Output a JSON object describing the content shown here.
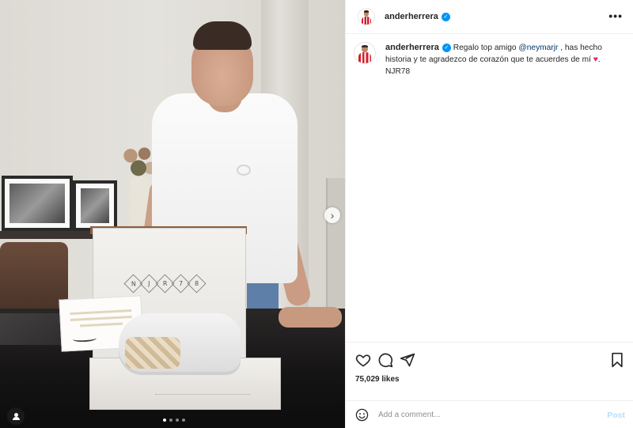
{
  "post": {
    "author": "anderherrera",
    "verified": true,
    "verified_icon": "verified-badge-icon",
    "more_label": "•••"
  },
  "caption": {
    "username": "anderherrera",
    "text_before": "Regalo top amigo ",
    "mention": "@neymarjr",
    "text_after": " , has hecho historia y te agradezco de corazón que te acuerdes de mí ",
    "emoji": "♥",
    "second_line": "NJR78"
  },
  "media": {
    "box_code": [
      "N",
      "J",
      "R",
      "7",
      "8"
    ],
    "next_icon": "chevron-right-icon",
    "tag_icon": "user-tag-icon",
    "carousel_count": 4,
    "carousel_active": 0
  },
  "actions": {
    "like_icon": "heart-icon",
    "comment_icon": "comment-icon",
    "share_icon": "send-icon",
    "save_icon": "bookmark-icon"
  },
  "likes": {
    "count_text": "75,029 likes"
  },
  "comment": {
    "placeholder": "Add a comment...",
    "post_label": "Post",
    "emoji_icon": "smiley-icon"
  },
  "colors": {
    "accent": "#0095f6",
    "post_disabled": "#b2dffc",
    "mention": "#00376b",
    "heart": "#e0245e"
  }
}
